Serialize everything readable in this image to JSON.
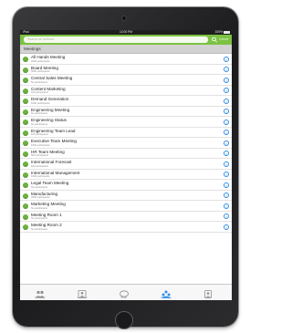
{
  "status_bar": {
    "carrier": "iPad",
    "time": "12:00 PM",
    "battery": "100%"
  },
  "search": {
    "placeholder": "Search all defined",
    "cancel_label": "Cancel"
  },
  "section": {
    "title": "Meetings"
  },
  "colors": {
    "accent": "#7cc243",
    "status_online": "#6cb33e",
    "info": "#2f8de4"
  },
  "meetings": [
    {
      "title": "All Hands Meeting",
      "subtitle": "2000 participants"
    },
    {
      "title": "Board Meeting",
      "subtitle": "5000 participants"
    },
    {
      "title": "Central Sales Meeting",
      "subtitle": "No participants"
    },
    {
      "title": "Content Marketing",
      "subtitle": "100 participants"
    },
    {
      "title": "Demand Generation",
      "subtitle": "1000 participants"
    },
    {
      "title": "Engineering Meeting",
      "subtitle": "No participants"
    },
    {
      "title": "Engineering Status",
      "subtitle": "No participants"
    },
    {
      "title": "Engineering Team Lead",
      "subtitle": "100 participants"
    },
    {
      "title": "Executive Team Meeting",
      "subtitle": "1000 participants"
    },
    {
      "title": "HR Team Meeting",
      "subtitle": "500 participants"
    },
    {
      "title": "International Forecast",
      "subtitle": "100 participants"
    },
    {
      "title": "International Management",
      "subtitle": "1000 participants"
    },
    {
      "title": "Legal Team Meeting",
      "subtitle": "No participants"
    },
    {
      "title": "Manufacturing",
      "subtitle": "2000 participants"
    },
    {
      "title": "Marketing Meeting",
      "subtitle": "No participants"
    },
    {
      "title": "Meeting Room 1",
      "subtitle": "No participants"
    },
    {
      "title": "Meeting Room 2",
      "subtitle": "No participants"
    }
  ],
  "tabs": [
    {
      "label": "Directory",
      "icon": "people-icon",
      "active": false
    },
    {
      "label": "Contacts",
      "icon": "contacts-icon",
      "active": false
    },
    {
      "label": "Chat",
      "icon": "chat-icon",
      "active": false
    },
    {
      "label": "Meetings",
      "icon": "meetings-icon",
      "active": true
    },
    {
      "label": "Calls",
      "icon": "calls-icon",
      "active": false
    }
  ]
}
